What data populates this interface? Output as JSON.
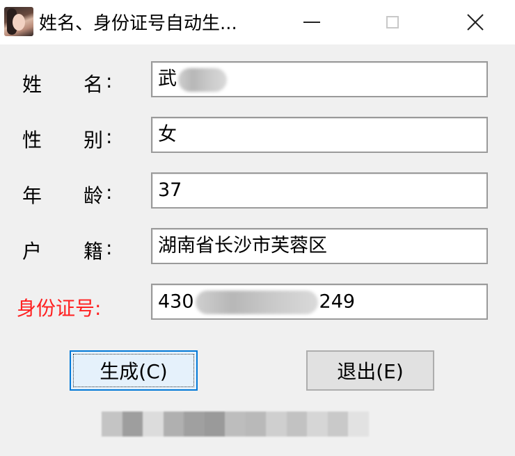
{
  "window": {
    "title": "姓名、身份证号自动生...",
    "minimize_glyph": "—",
    "close_glyph": "✕"
  },
  "form": {
    "name": {
      "label_a": "姓",
      "label_b": "名",
      "label_c": ":",
      "value_visible": "武"
    },
    "gender": {
      "label_a": "性",
      "label_b": "别",
      "label_c": ":",
      "value": "女"
    },
    "age": {
      "label_a": "年",
      "label_b": "龄",
      "label_c": ":",
      "value": "37"
    },
    "hometown": {
      "label_a": "户",
      "label_b": "籍",
      "label_c": ":",
      "value": "湖南省长沙市芙蓉区"
    },
    "id_number": {
      "label": "身份证号:",
      "value_prefix": "430",
      "value_suffix": "249"
    }
  },
  "buttons": {
    "generate": "生成(C)",
    "exit": "退出(E)"
  },
  "colors": {
    "label_highlight": "#ff2020",
    "default_button_border": "#0078d7"
  }
}
